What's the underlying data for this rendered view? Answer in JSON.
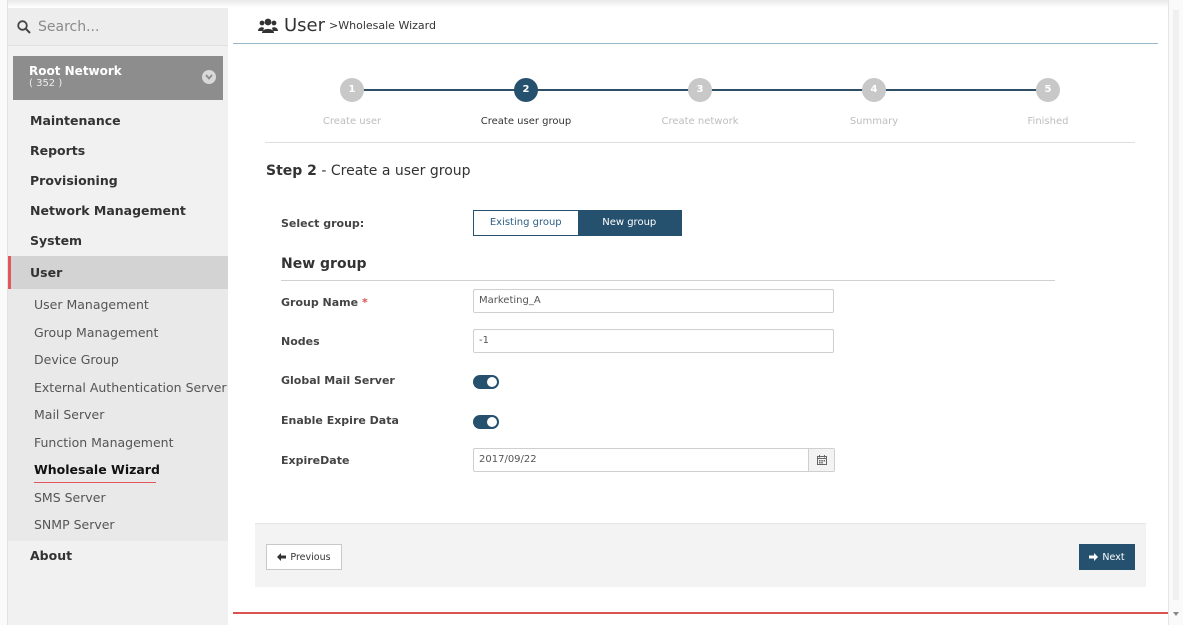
{
  "search": {
    "placeholder": "Search..."
  },
  "root_network": {
    "name": "Root Network",
    "count": "( 352 )"
  },
  "nav": {
    "maintenance": "Maintenance",
    "reports": "Reports",
    "provisioning": "Provisioning",
    "network_management": "Network Management",
    "system": "System",
    "user": "User",
    "about": "About"
  },
  "user_submenu": [
    "User Management",
    "Group Management",
    "Device Group",
    "External Authentication Server",
    "Mail Server",
    "Function Management",
    "Wholesale Wizard",
    "SMS Server",
    "SNMP Server"
  ],
  "header": {
    "title": "User",
    "breadcrumb": ">Wholesale Wizard"
  },
  "wizard": {
    "steps": [
      {
        "num": "1",
        "label": "Create user"
      },
      {
        "num": "2",
        "label": "Create user group"
      },
      {
        "num": "3",
        "label": "Create network"
      },
      {
        "num": "4",
        "label": "Summary"
      },
      {
        "num": "5",
        "label": "Finished"
      }
    ],
    "active_step": 2,
    "heading_bold": "Step 2",
    "heading_rest": " - Create a user group"
  },
  "form": {
    "select_group_label": "Select group:",
    "existing_group": "Existing group",
    "new_group": "New group",
    "section_title": "New group",
    "group_name_label": "Group Name",
    "required_mark": "*",
    "group_name_value": "Marketing_A",
    "nodes_label": "Nodes",
    "nodes_value": "-1",
    "global_mail_label": "Global Mail Server",
    "global_mail_on": true,
    "enable_expire_label": "Enable Expire Data",
    "enable_expire_on": true,
    "expire_date_label": "ExpireDate",
    "expire_date_value": "2017/09/22"
  },
  "footer": {
    "previous": "Previous",
    "next": "Next"
  },
  "colors": {
    "accent": "#25506e",
    "highlight": "#e2565d"
  }
}
